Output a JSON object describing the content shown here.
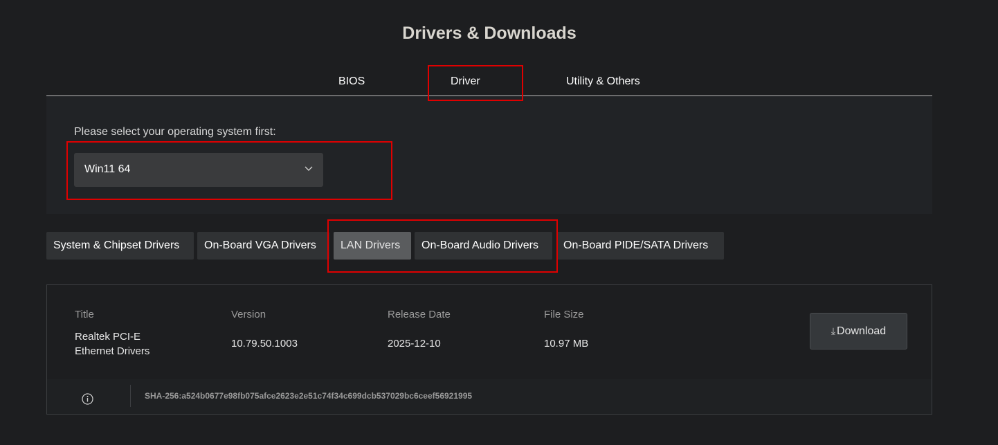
{
  "page": {
    "title": "Drivers & Downloads"
  },
  "tabs": [
    {
      "label": "BIOS"
    },
    {
      "label": "Driver"
    },
    {
      "label": "Utility & Others"
    }
  ],
  "os_selector": {
    "label": "Please select your operating system first:",
    "selected": "Win11 64"
  },
  "categories": [
    {
      "label": "System & Chipset Drivers"
    },
    {
      "label": "On-Board VGA Drivers"
    },
    {
      "label": "LAN Drivers"
    },
    {
      "label": "On-Board Audio Drivers"
    },
    {
      "label": "On-Board PIDE/SATA Drivers"
    }
  ],
  "driver_table": {
    "headers": {
      "title": "Title",
      "version": "Version",
      "release_date": "Release Date",
      "file_size": "File Size"
    },
    "row": {
      "title": "Realtek PCI-E Ethernet Drivers",
      "version": "10.79.50.1003",
      "release_date": "2025-12-10",
      "file_size": "10.97 MB"
    },
    "download_label": "Download",
    "download_icon_glyph": "⤓",
    "hash": "SHA-256:a524b0677e98fb075afce2623e2e51c74f34c699dcb537029bc6ceef56921995"
  },
  "icons": {
    "select": "chevron-down-icon",
    "download": "download-arrow-icon",
    "hash_info": "info-icon"
  },
  "colors": {
    "background": "#1d1e20",
    "panel": "#212326",
    "button": "#303234",
    "active_button": "#5a5c5e",
    "highlight": "#e00000"
  }
}
